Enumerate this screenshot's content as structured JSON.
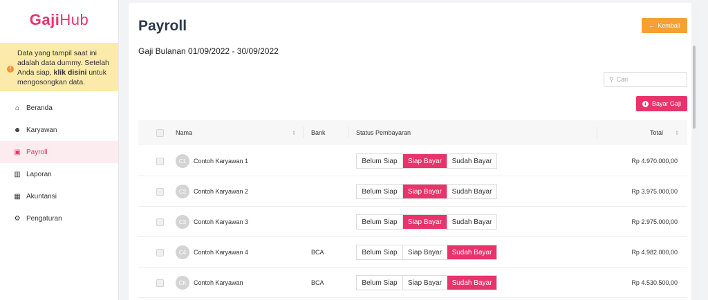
{
  "brand": {
    "bold": "Gaji",
    "light": "Hub"
  },
  "notice": {
    "text1": "Data yang tampil saat ini adalah data dummy. Setelah Anda siap, ",
    "link": "klik disini",
    "text2": " untuk mengosongkan data."
  },
  "nav": [
    {
      "label": "Beranda",
      "icon": "home-icon"
    },
    {
      "label": "Karyawan",
      "icon": "users-icon"
    },
    {
      "label": "Payroll",
      "icon": "payroll-icon"
    },
    {
      "label": "Laporan",
      "icon": "chart-icon"
    },
    {
      "label": "Akuntansi",
      "icon": "grid-icon"
    },
    {
      "label": "Pengaturan",
      "icon": "gear-icon"
    }
  ],
  "page": {
    "title": "Payroll",
    "subtitle": "Gaji Bulanan 01/09/2022 - 30/09/2022",
    "back_label": "Kembali",
    "search_placeholder": "Cari",
    "pay_label": "Bayar Gaji"
  },
  "table": {
    "headers": {
      "name": "Nama",
      "bank": "Bank",
      "status": "Status Pembayaran",
      "total": "Total"
    },
    "status_options": [
      "Belum Siap",
      "Siap Bayar",
      "Sudah Bayar"
    ],
    "rows": [
      {
        "initials": "C1",
        "name": "Contoh Karyawan 1",
        "bank": "",
        "status": "Siap Bayar",
        "total": "Rp 4.970.000,00"
      },
      {
        "initials": "C2",
        "name": "Contoh Karyawan 2",
        "bank": "",
        "status": "Siap Bayar",
        "total": "Rp 3.975.000,00"
      },
      {
        "initials": "C3",
        "name": "Contoh Karyawan 3",
        "bank": "",
        "status": "Siap Bayar",
        "total": "Rp 2.975.000,00"
      },
      {
        "initials": "C4",
        "name": "Contoh Karyawan 4",
        "bank": "BCA",
        "status": "Sudah Bayar",
        "total": "Rp 4.982.000,00"
      },
      {
        "initials": "CK",
        "name": "Contoh Karyawan",
        "bank": "BCA",
        "status": "Sudah Bayar",
        "total": "Rp 4.530.500,00"
      }
    ]
  },
  "colors": {
    "brand": "#e8336b",
    "back_button": "#f5a031",
    "notice_bg": "#fbeaa9"
  }
}
